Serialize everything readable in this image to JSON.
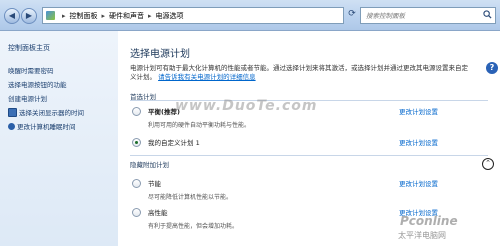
{
  "titlebar": {
    "breadcrumbs": [
      "控制面板",
      "硬件和声音",
      "电源选项"
    ],
    "search_placeholder": "搜索控制面板"
  },
  "sidebar": {
    "title": "控制面板主页",
    "links": [
      {
        "label": "唤醒时需要密码",
        "icon": ""
      },
      {
        "label": "选择电源按钮的功能",
        "icon": ""
      },
      {
        "label": "创建电源计划",
        "icon": ""
      },
      {
        "label": "选择关闭显示器的时间",
        "icon": "monitor-icon"
      },
      {
        "label": "更改计算机睡眠时间",
        "icon": "moon-icon"
      }
    ]
  },
  "main": {
    "heading": "选择电源计划",
    "description": "电源计划可有助于最大化计算机的性能或者节能。通过选择计划来将其激活，或选择计划并通过更改其电源设置来自定义计划。",
    "description_link": "请告诉我有关电源计划的详细信息",
    "primary_section": "首选计划",
    "hidden_section": "隐藏附加计划",
    "change_settings_label": "更改计划设置",
    "plans_primary": [
      {
        "name": "平衡",
        "tag": "(推荐)",
        "subtitle": "利用可用的硬件自动平衡功耗与性能。",
        "checked": false
      },
      {
        "name": "我的自定义计划 1",
        "tag": "",
        "subtitle": "",
        "checked": true
      }
    ],
    "plans_hidden": [
      {
        "name": "节能",
        "tag": "",
        "subtitle": "尽可能降低计算机性能以节能。",
        "checked": false
      },
      {
        "name": "高性能",
        "tag": "",
        "subtitle": "有利于提高性能，但会增加功耗。",
        "checked": false
      }
    ]
  },
  "watermarks": {
    "center": "www.DuoTe.com",
    "corner_top": "Pconline",
    "corner_bottom": "太平洋电脑网"
  },
  "colors": {
    "accent_link": "#0066cc",
    "heading": "#1e395b"
  }
}
